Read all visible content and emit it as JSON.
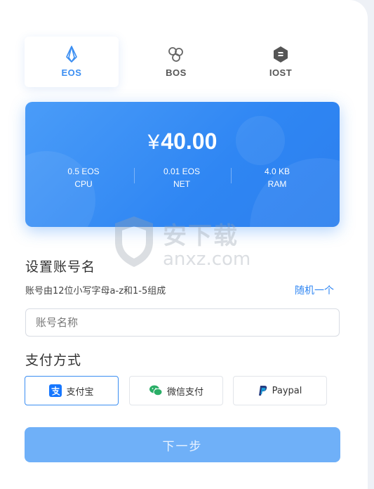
{
  "chains": [
    {
      "label": "EOS",
      "icon": "eos-icon",
      "active": true
    },
    {
      "label": "BOS",
      "icon": "bos-icon",
      "active": false
    },
    {
      "label": "IOST",
      "icon": "iost-icon",
      "active": false
    }
  ],
  "card": {
    "currency": "¥",
    "amount": "40.00",
    "resources": [
      {
        "value": "0.5 EOS",
        "name": "CPU"
      },
      {
        "value": "0.01 EOS",
        "name": "NET"
      },
      {
        "value": "4.0 KB",
        "name": "RAM"
      }
    ]
  },
  "account": {
    "section_title": "设置账号名",
    "hint": "账号由12位小写字母a-z和1-5组成",
    "random_link": "随机一个",
    "placeholder": "账号名称",
    "value": ""
  },
  "payment": {
    "section_title": "支付方式",
    "methods": [
      {
        "label": "支付宝",
        "icon": "alipay-icon",
        "active": true
      },
      {
        "label": "微信支付",
        "icon": "wechat-icon",
        "active": false
      },
      {
        "label": "Paypal",
        "icon": "paypal-icon",
        "active": false
      }
    ]
  },
  "next_button": "下一步",
  "watermark": {
    "cn": "安下载",
    "en": "anxz.com"
  },
  "colors": {
    "accent": "#2f86f3",
    "button": "#6fb0f8",
    "border": "#d8dce3"
  }
}
